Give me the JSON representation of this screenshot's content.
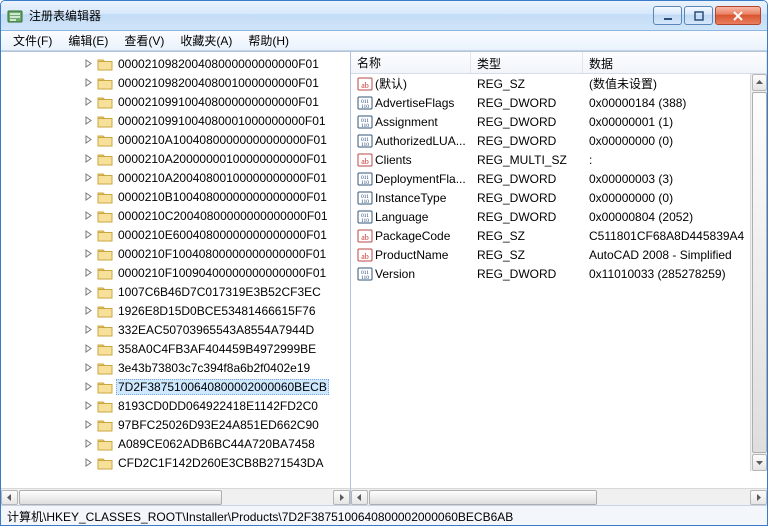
{
  "window": {
    "title": "注册表编辑器"
  },
  "menu": {
    "file": "文件(F)",
    "edit": "编辑(E)",
    "view": "查看(V)",
    "favorites": "收藏夹(A)",
    "help": "帮助(H)"
  },
  "tree": {
    "items": [
      {
        "label": "000021098200408000000000000F01"
      },
      {
        "label": "000021098200408001000000000F01"
      },
      {
        "label": "000021099100408000000000000F01"
      },
      {
        "label": "0000210991004080001000000000F01"
      },
      {
        "label": "0000210A10040800000000000000F01"
      },
      {
        "label": "0000210A20000000100000000000F01"
      },
      {
        "label": "0000210A20040800100000000000F01"
      },
      {
        "label": "0000210B10040800000000000000F01"
      },
      {
        "label": "0000210C20040800000000000000F01"
      },
      {
        "label": "0000210E60040800000000000000F01"
      },
      {
        "label": "0000210F10040800000000000000F01"
      },
      {
        "label": "0000210F10090400000000000000F01"
      },
      {
        "label": "1007C6B46D7C017319E3B52CF3EC"
      },
      {
        "label": "1926E8D15D0BCE53481466615F76"
      },
      {
        "label": "332EAC50703965543A8554A7944D"
      },
      {
        "label": "358A0C4FB3AF404459B4972999BE"
      },
      {
        "label": "3e43b73803c7c394f8a6b2f0402e19"
      },
      {
        "label": "7D2F3875100640800002000060BECB",
        "selected": true
      },
      {
        "label": "8193CD0DD064922418E1142FD2C0"
      },
      {
        "label": "97BFC25026D93E24A851ED662C90"
      },
      {
        "label": "A089CE062ADB6BC44A720BA7458"
      },
      {
        "label": "CFD2C1F142D260E3CB8B271543DA"
      }
    ]
  },
  "listHeader": {
    "name": "名称",
    "type": "类型",
    "data": "数据"
  },
  "list": {
    "rows": [
      {
        "icon": "sz",
        "name": "(默认)",
        "type": "REG_SZ",
        "data": "(数值未设置)"
      },
      {
        "icon": "dw",
        "name": "AdvertiseFlags",
        "type": "REG_DWORD",
        "data": "0x00000184 (388)"
      },
      {
        "icon": "dw",
        "name": "Assignment",
        "type": "REG_DWORD",
        "data": "0x00000001 (1)"
      },
      {
        "icon": "dw",
        "name": "AuthorizedLUA...",
        "type": "REG_DWORD",
        "data": "0x00000000 (0)"
      },
      {
        "icon": "sz",
        "name": "Clients",
        "type": "REG_MULTI_SZ",
        "data": ":"
      },
      {
        "icon": "dw",
        "name": "DeploymentFla...",
        "type": "REG_DWORD",
        "data": "0x00000003 (3)"
      },
      {
        "icon": "dw",
        "name": "InstanceType",
        "type": "REG_DWORD",
        "data": "0x00000000 (0)"
      },
      {
        "icon": "dw",
        "name": "Language",
        "type": "REG_DWORD",
        "data": "0x00000804 (2052)"
      },
      {
        "icon": "sz",
        "name": "PackageCode",
        "type": "REG_SZ",
        "data": "C511801CF68A8D445839A4"
      },
      {
        "icon": "sz",
        "name": "ProductName",
        "type": "REG_SZ",
        "data": "AutoCAD 2008 - Simplified"
      },
      {
        "icon": "dw",
        "name": "Version",
        "type": "REG_DWORD",
        "data": "0x11010033 (285278259)"
      }
    ]
  },
  "status": {
    "path": "计算机\\HKEY_CLASSES_ROOT\\Installer\\Products\\7D2F3875100640800002000060BECB6AB"
  }
}
